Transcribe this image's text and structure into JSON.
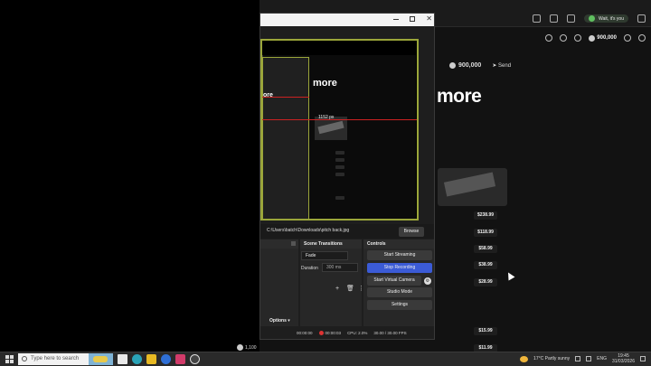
{
  "browser": {
    "profile_label": "Wait, it's you",
    "nav_balance": "900,000",
    "balance": "900,000",
    "send_label": "Send",
    "heading": "more",
    "prices": [
      "$238.99",
      "$118.99",
      "$58.99",
      "$38.99",
      "$28.99",
      "$15.99",
      "$11.99"
    ]
  },
  "obs": {
    "preview": {
      "nested_heading": "more",
      "nested_heading_small": "ore",
      "coordinate_label": "1152 px"
    },
    "image_path": "C:\\Users\\batch\\Downloads\\pitch back.jpg",
    "browse_label": "Browse",
    "docks": {
      "transitions_title": "Scene Transitions",
      "controls_title": "Controls"
    },
    "transition_value": "Fade",
    "duration_label": "Duration",
    "duration_value": "300 ms",
    "controls": {
      "start_streaming": "Start Streaming",
      "stop_recording": "Stop Recording",
      "start_virtual_camera": "Start Virtual Camera",
      "studio_mode": "Studio Mode",
      "settings": "Settings"
    },
    "options_label": "Options",
    "status": {
      "stream_time": "00:00:00",
      "rec_time": "00:00:03",
      "cpu": "CPU: 2.0%",
      "fps": "30.00 / 30.00 FPS"
    }
  },
  "taskbar": {
    "search_placeholder": "Type here to search",
    "weather": "17°C  Partly sunny",
    "language": "ENG",
    "time": "19:45",
    "date": "31/03/2026"
  },
  "bottom_balance": "1,100"
}
